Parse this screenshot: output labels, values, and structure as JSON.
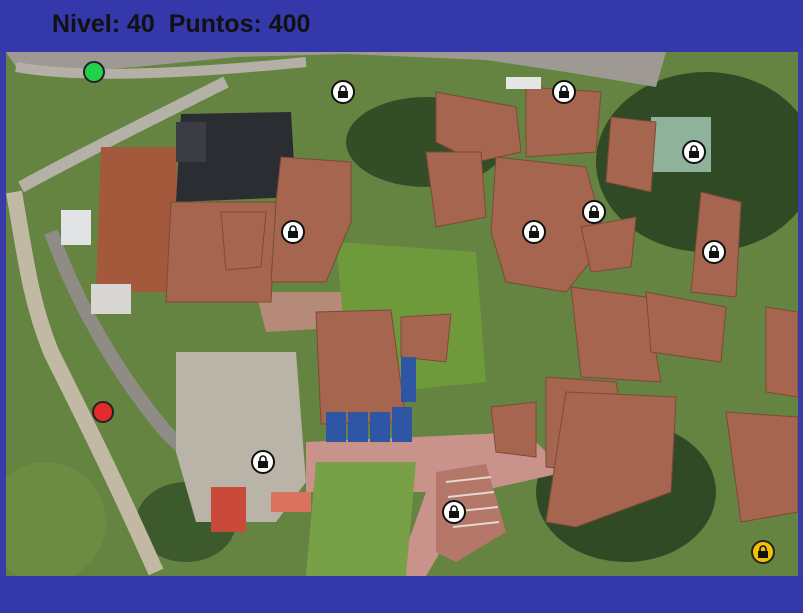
{
  "hud": {
    "level_text": "Nivel: 40",
    "points_text": "Puntos: 400"
  },
  "colors": {
    "frame": "#3438ab",
    "start_marker": "#22d24a",
    "current_marker": "#e52a2a",
    "locked_marker": "#ffffff",
    "special_locked_marker": "#f2c200"
  },
  "map": {
    "scene": "aerial campus photo"
  },
  "markers": {
    "start": {
      "icon": "green-circle"
    },
    "player": {
      "icon": "red-circle"
    },
    "locks": [
      {
        "icon": "lock-icon",
        "state": "locked"
      },
      {
        "icon": "lock-icon",
        "state": "locked"
      },
      {
        "icon": "lock-icon",
        "state": "locked"
      },
      {
        "icon": "lock-icon",
        "state": "locked"
      },
      {
        "icon": "lock-icon",
        "state": "locked"
      },
      {
        "icon": "lock-icon",
        "state": "locked"
      },
      {
        "icon": "lock-icon",
        "state": "locked"
      },
      {
        "icon": "lock-icon",
        "state": "locked"
      },
      {
        "icon": "lock-icon",
        "state": "locked"
      },
      {
        "icon": "lock-icon",
        "state": "locked-special"
      }
    ]
  }
}
